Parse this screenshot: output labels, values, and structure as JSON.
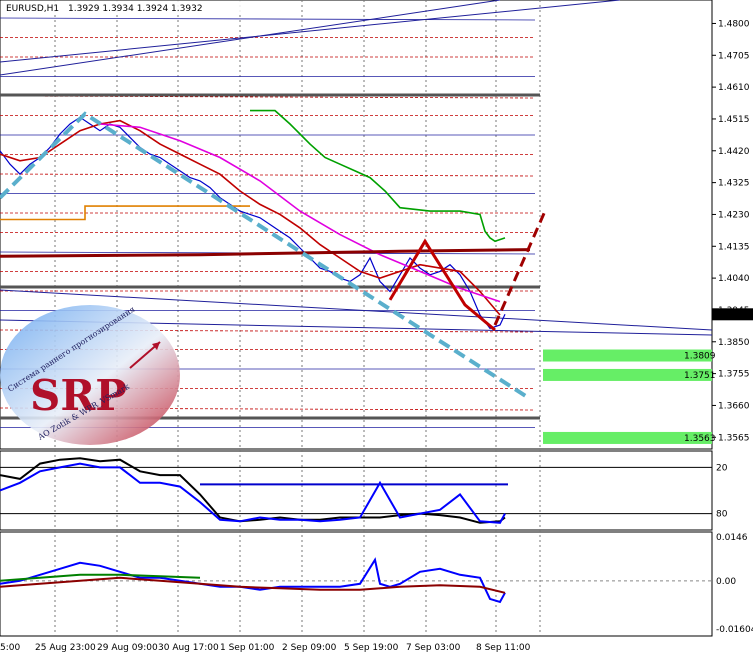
{
  "window": {
    "symbol_info": "EURUSD,H1",
    "ohlc": "1.3929 1.3934 1.3924 1.3932"
  },
  "chart_data": {
    "type": "line",
    "title": "EURUSD,H1 1.3929 1.3934 1.3924 1.3932",
    "xlabel": "",
    "ylabel": "",
    "price_axis": {
      "ticks": [
        "1.4800",
        "1.4705",
        "1.4610",
        "1.4515",
        "1.4420",
        "1.4325",
        "1.4230",
        "1.4135",
        "1.4040",
        "1.3945",
        "1.3850",
        "1.3755",
        "1.3660",
        "1.3565"
      ],
      "ylim": [
        1.353,
        1.487
      ],
      "current_price": "1.3932"
    },
    "time_axis": [
      "5:00",
      "25 Aug 23:00",
      "29 Aug 09:00",
      "30 Aug 17:00",
      "1 Sep 01:00",
      "2 Sep 09:00",
      "5 Sep 19:00",
      "7 Sep 03:00",
      "8 Sep 11:00"
    ],
    "grid": true,
    "forecast_levels": [
      {
        "label": "1.3809",
        "value": 1.3809
      },
      {
        "label": "1.3751",
        "value": 1.3751
      },
      {
        "label": "1.3563",
        "value": 1.3563
      }
    ],
    "price_series": [
      {
        "name": "close",
        "color": "#0000cc",
        "x": [
          0,
          10,
          20,
          30,
          40,
          50,
          60,
          70,
          80,
          90,
          100,
          110,
          120,
          130,
          140,
          150,
          160,
          170,
          180,
          190,
          200,
          210,
          220,
          230,
          240,
          250,
          260,
          270,
          280,
          290,
          300,
          310,
          320,
          330,
          340,
          350,
          360,
          370,
          380,
          390,
          400,
          410,
          420,
          430,
          440,
          450,
          460,
          470,
          480,
          490,
          500,
          505
        ],
        "y": [
          1.442,
          1.438,
          1.435,
          1.438,
          1.44,
          1.443,
          1.447,
          1.45,
          1.452,
          1.45,
          1.448,
          1.45,
          1.449,
          1.446,
          1.443,
          1.441,
          1.44,
          1.438,
          1.436,
          1.434,
          1.433,
          1.431,
          1.428,
          1.426,
          1.424,
          1.423,
          1.422,
          1.42,
          1.418,
          1.416,
          1.413,
          1.41,
          1.407,
          1.406,
          1.404,
          1.403,
          1.405,
          1.41,
          1.403,
          1.4,
          1.405,
          1.41,
          1.407,
          1.405,
          1.406,
          1.408,
          1.405,
          1.4,
          1.393,
          1.389,
          1.39,
          1.3932
        ]
      },
      {
        "name": "ma-red",
        "color": "#c00000",
        "x": [
          0,
          20,
          40,
          60,
          80,
          100,
          120,
          140,
          160,
          180,
          200,
          220,
          240,
          260,
          280,
          300,
          320,
          340,
          360,
          380,
          400,
          420,
          440,
          460,
          480,
          500
        ],
        "y": [
          1.441,
          1.439,
          1.44,
          1.444,
          1.448,
          1.45,
          1.451,
          1.448,
          1.444,
          1.441,
          1.438,
          1.435,
          1.43,
          1.426,
          1.423,
          1.419,
          1.414,
          1.41,
          1.406,
          1.404,
          1.406,
          1.408,
          1.407,
          1.406,
          1.4,
          1.393
        ]
      },
      {
        "name": "ma-magenta",
        "color": "#e000e0",
        "x": [
          100,
          140,
          180,
          220,
          260,
          300,
          340,
          380,
          420,
          460,
          500
        ],
        "y": [
          1.45,
          1.449,
          1.445,
          1.44,
          1.433,
          1.424,
          1.417,
          1.411,
          1.406,
          1.401,
          1.397
        ]
      },
      {
        "name": "ma-green",
        "color": "#00a000",
        "x": [
          250,
          275,
          290,
          300,
          310,
          325,
          340,
          355,
          370,
          385,
          400,
          430,
          460,
          480,
          485,
          490,
          495,
          505
        ],
        "y": [
          1.454,
          1.454,
          1.45,
          1.447,
          1.444,
          1.44,
          1.438,
          1.436,
          1.434,
          1.43,
          1.425,
          1.424,
          1.424,
          1.423,
          1.418,
          1.416,
          1.415,
          1.416
        ]
      },
      {
        "name": "level-orange",
        "color": "#e08000",
        "x": [
          0,
          85,
          85,
          250
        ],
        "y": [
          1.4215,
          1.4215,
          1.4255,
          1.4255
        ]
      },
      {
        "name": "level-brown",
        "color": "#8b0000",
        "x": [
          0,
          200,
          400,
          530
        ],
        "y": [
          1.4105,
          1.411,
          1.412,
          1.4125
        ]
      },
      {
        "name": "zigzag-red",
        "color": "#c00000",
        "x": [
          390,
          425,
          465,
          495
        ],
        "y": [
          1.3975,
          1.415,
          1.396,
          1.3885
        ]
      },
      {
        "name": "trend-teal",
        "color": "#5aafcc",
        "x": [
          0,
          85,
          530
        ],
        "y": [
          1.428,
          1.453,
          1.368
        ]
      }
    ],
    "indicator_1": {
      "levels": [
        "20",
        "80"
      ],
      "series": [
        {
          "name": "black",
          "color": "#000000",
          "x": [
            0,
            20,
            40,
            60,
            80,
            100,
            120,
            140,
            160,
            180,
            200,
            220,
            240,
            260,
            280,
            300,
            320,
            340,
            360,
            380,
            400,
            420,
            440,
            460,
            480,
            500,
            505
          ],
          "y": [
            30,
            35,
            15,
            10,
            8,
            12,
            10,
            25,
            30,
            30,
            55,
            85,
            90,
            88,
            85,
            88,
            88,
            85,
            85,
            85,
            82,
            80,
            82,
            85,
            92,
            90,
            85
          ]
        },
        {
          "name": "blue",
          "color": "#0000ff",
          "x": [
            0,
            20,
            40,
            60,
            80,
            100,
            120,
            140,
            160,
            180,
            200,
            220,
            240,
            260,
            280,
            300,
            320,
            340,
            360,
            380,
            400,
            420,
            440,
            460,
            480,
            500,
            505
          ],
          "y": [
            50,
            40,
            25,
            20,
            15,
            20,
            20,
            40,
            40,
            45,
            65,
            88,
            90,
            85,
            88,
            88,
            90,
            88,
            85,
            40,
            85,
            80,
            75,
            55,
            90,
            92,
            80
          ]
        }
      ]
    },
    "indicator_2": {
      "levels": [
        "0.0146",
        "0.00",
        "-0.01604"
      ],
      "series": [
        {
          "name": "blue",
          "color": "#0000ff",
          "x": [
            0,
            20,
            40,
            60,
            80,
            100,
            120,
            140,
            160,
            180,
            200,
            220,
            240,
            260,
            280,
            300,
            320,
            340,
            360,
            375,
            380,
            390,
            400,
            420,
            440,
            460,
            480,
            490,
            500,
            505
          ],
          "y": [
            -0.001,
            0.0,
            0.002,
            0.004,
            0.006,
            0.005,
            0.003,
            0.001,
            0.001,
            0.0,
            -0.001,
            -0.002,
            -0.002,
            -0.003,
            -0.002,
            -0.002,
            -0.002,
            -0.002,
            -0.001,
            0.007,
            -0.001,
            -0.002,
            -0.001,
            0.003,
            0.004,
            0.002,
            0.001,
            -0.006,
            -0.007,
            -0.004
          ]
        },
        {
          "name": "darkred",
          "color": "#8b0000",
          "x": [
            0,
            40,
            80,
            120,
            160,
            200,
            240,
            280,
            320,
            360,
            400,
            440,
            480,
            505
          ],
          "y": [
            -0.002,
            -0.001,
            0.0,
            0.001,
            0.0,
            -0.001,
            -0.002,
            -0.0025,
            -0.003,
            -0.003,
            -0.002,
            -0.0015,
            -0.002,
            -0.004
          ]
        },
        {
          "name": "green",
          "color": "#008000",
          "x": [
            0,
            40,
            80,
            120,
            160,
            200
          ],
          "y": [
            0.0,
            0.001,
            0.002,
            0.002,
            0.0015,
            0.001
          ]
        }
      ]
    }
  },
  "watermark": {
    "letters": "SRP",
    "caption_top": "Система раннего прогнозирования",
    "caption_bottom": "AO Zotik & WPR_VSmark"
  }
}
